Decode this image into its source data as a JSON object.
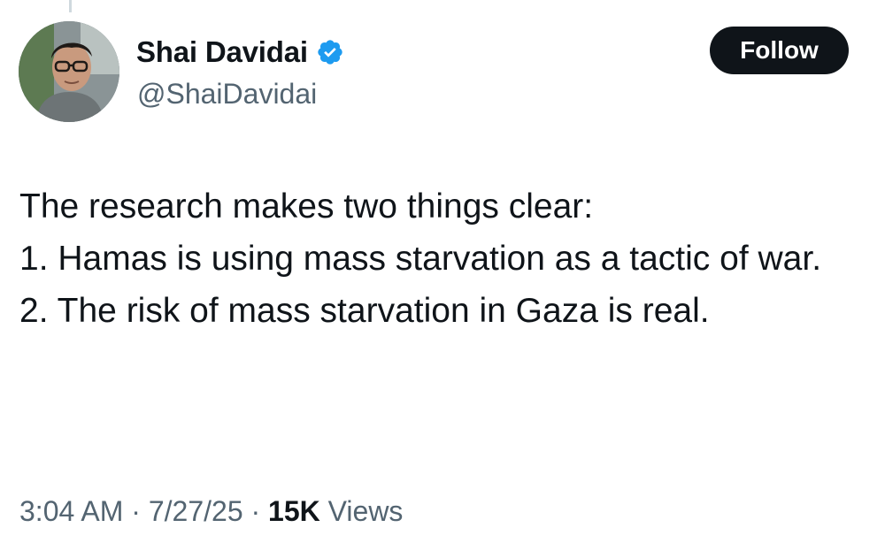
{
  "author": {
    "display_name": "Shai Davidai",
    "handle": "@ShaiDavidai",
    "verified": true,
    "verified_icon": "verified-badge-icon"
  },
  "follow_button": {
    "label": "Follow"
  },
  "tweet": {
    "lines": [
      "The research makes two things clear:",
      "",
      "1. Hamas is using mass starvation as a tactic of war.",
      "2. The risk of mass starvation in Gaza is real."
    ]
  },
  "meta": {
    "time": "3:04 AM",
    "separator": " · ",
    "date": "7/27/25",
    "views_count": "15K",
    "views_label": " Views"
  },
  "colors": {
    "text_primary": "#0f1419",
    "text_secondary": "#536471",
    "verified_blue": "#1d9bf0",
    "button_bg": "#0f1419"
  }
}
